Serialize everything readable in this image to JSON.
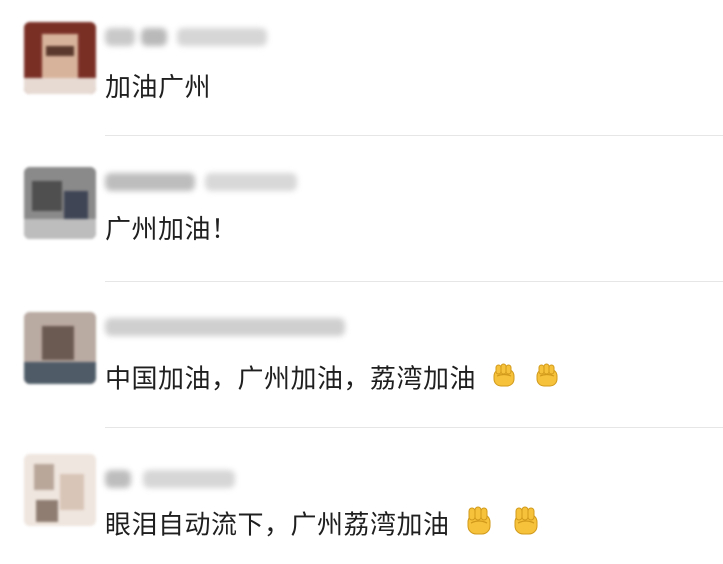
{
  "comments": [
    {
      "text": "加油广州",
      "emojis": []
    },
    {
      "text": "广州加油！",
      "emojis": []
    },
    {
      "text": "中国加油，广州加油，荔湾加油",
      "emojis": [
        "fist-icon",
        "fist-icon"
      ]
    },
    {
      "text": "眼泪自动流下，广州荔湾加油",
      "emojis": [
        "raised-fist-icon",
        "raised-fist-icon"
      ]
    }
  ]
}
